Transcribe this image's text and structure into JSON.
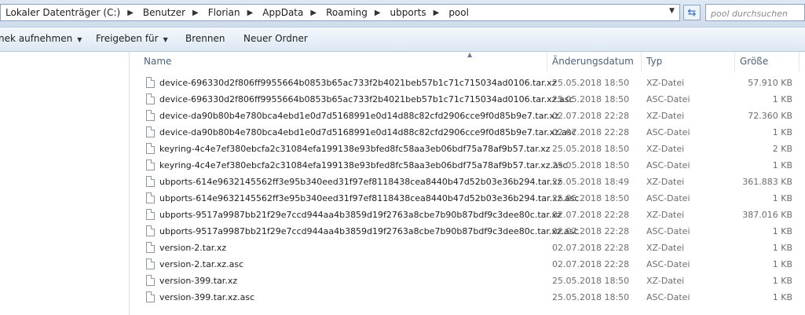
{
  "address": {
    "crumbs": [
      "Lokaler Datenträger (C:)",
      "Benutzer",
      "Florian",
      "AppData",
      "Roaming",
      "ubports",
      "pool"
    ],
    "separator": "▶",
    "dropdown_icon": "chevron-down-icon",
    "refresh_icon": "refresh-icon"
  },
  "search": {
    "placeholder": "pool durchsuchen"
  },
  "toolbar": {
    "include_label": "nek aufnehmen",
    "share_label": "Freigeben für",
    "burn_label": "Brennen",
    "new_folder_label": "Neuer Ordner"
  },
  "columns": {
    "name": "Name",
    "date": "Änderungsdatum",
    "type": "Typ",
    "size": "Größe"
  },
  "files": [
    {
      "name": "device-696330d2f806ff9955664b0853b65ac733f2b4021beb57b1c71c715034ad0106.tar.xz",
      "date": "25.05.2018 18:50",
      "type": "XZ-Datei",
      "size": "57.910 KB"
    },
    {
      "name": "device-696330d2f806ff9955664b0853b65ac733f2b4021beb57b1c71c715034ad0106.tar.xz.asc",
      "date": "25.05.2018 18:50",
      "type": "ASC-Datei",
      "size": "1 KB"
    },
    {
      "name": "device-da90b80b4e780bca4ebd1e0d7d5168991e0d14d88c82cfd2906cce9f0d85b9e7.tar.xz",
      "date": "02.07.2018 22:28",
      "type": "XZ-Datei",
      "size": "72.360 KB"
    },
    {
      "name": "device-da90b80b4e780bca4ebd1e0d7d5168991e0d14d88c82cfd2906cce9f0d85b9e7.tar.xz.asc",
      "date": "02.07.2018 22:28",
      "type": "ASC-Datei",
      "size": "1 KB"
    },
    {
      "name": "keyring-4c4e7ef380ebcfa2c31084efa199138e93bfed8fc58aa3eb06bdf75a78af9b57.tar.xz",
      "date": "25.05.2018 18:50",
      "type": "XZ-Datei",
      "size": "2 KB"
    },
    {
      "name": "keyring-4c4e7ef380ebcfa2c31084efa199138e93bfed8fc58aa3eb06bdf75a78af9b57.tar.xz.asc",
      "date": "25.05.2018 18:50",
      "type": "ASC-Datei",
      "size": "1 KB"
    },
    {
      "name": "ubports-614e9632145562ff3e95b340eed31f97ef8118438cea8440b47d52b03e36b294.tar.xz",
      "date": "25.05.2018 18:49",
      "type": "XZ-Datei",
      "size": "361.883 KB"
    },
    {
      "name": "ubports-614e9632145562ff3e95b340eed31f97ef8118438cea8440b47d52b03e36b294.tar.xz.asc",
      "date": "25.05.2018 18:50",
      "type": "ASC-Datei",
      "size": "1 KB"
    },
    {
      "name": "ubports-9517a9987bb21f29e7ccd944aa4b3859d19f2763a8cbe7b90b87bdf9c3dee80c.tar.xz",
      "date": "02.07.2018 22:28",
      "type": "XZ-Datei",
      "size": "387.016 KB"
    },
    {
      "name": "ubports-9517a9987bb21f29e7ccd944aa4b3859d19f2763a8cbe7b90b87bdf9c3dee80c.tar.xz.asc",
      "date": "02.07.2018 22:28",
      "type": "ASC-Datei",
      "size": "1 KB"
    },
    {
      "name": "version-2.tar.xz",
      "date": "02.07.2018 22:28",
      "type": "XZ-Datei",
      "size": "1 KB"
    },
    {
      "name": "version-2.tar.xz.asc",
      "date": "02.07.2018 22:28",
      "type": "ASC-Datei",
      "size": "1 KB"
    },
    {
      "name": "version-399.tar.xz",
      "date": "25.05.2018 18:50",
      "type": "XZ-Datei",
      "size": "1 KB"
    },
    {
      "name": "version-399.tar.xz.asc",
      "date": "25.05.2018 18:50",
      "type": "ASC-Datei",
      "size": "1 KB"
    }
  ]
}
